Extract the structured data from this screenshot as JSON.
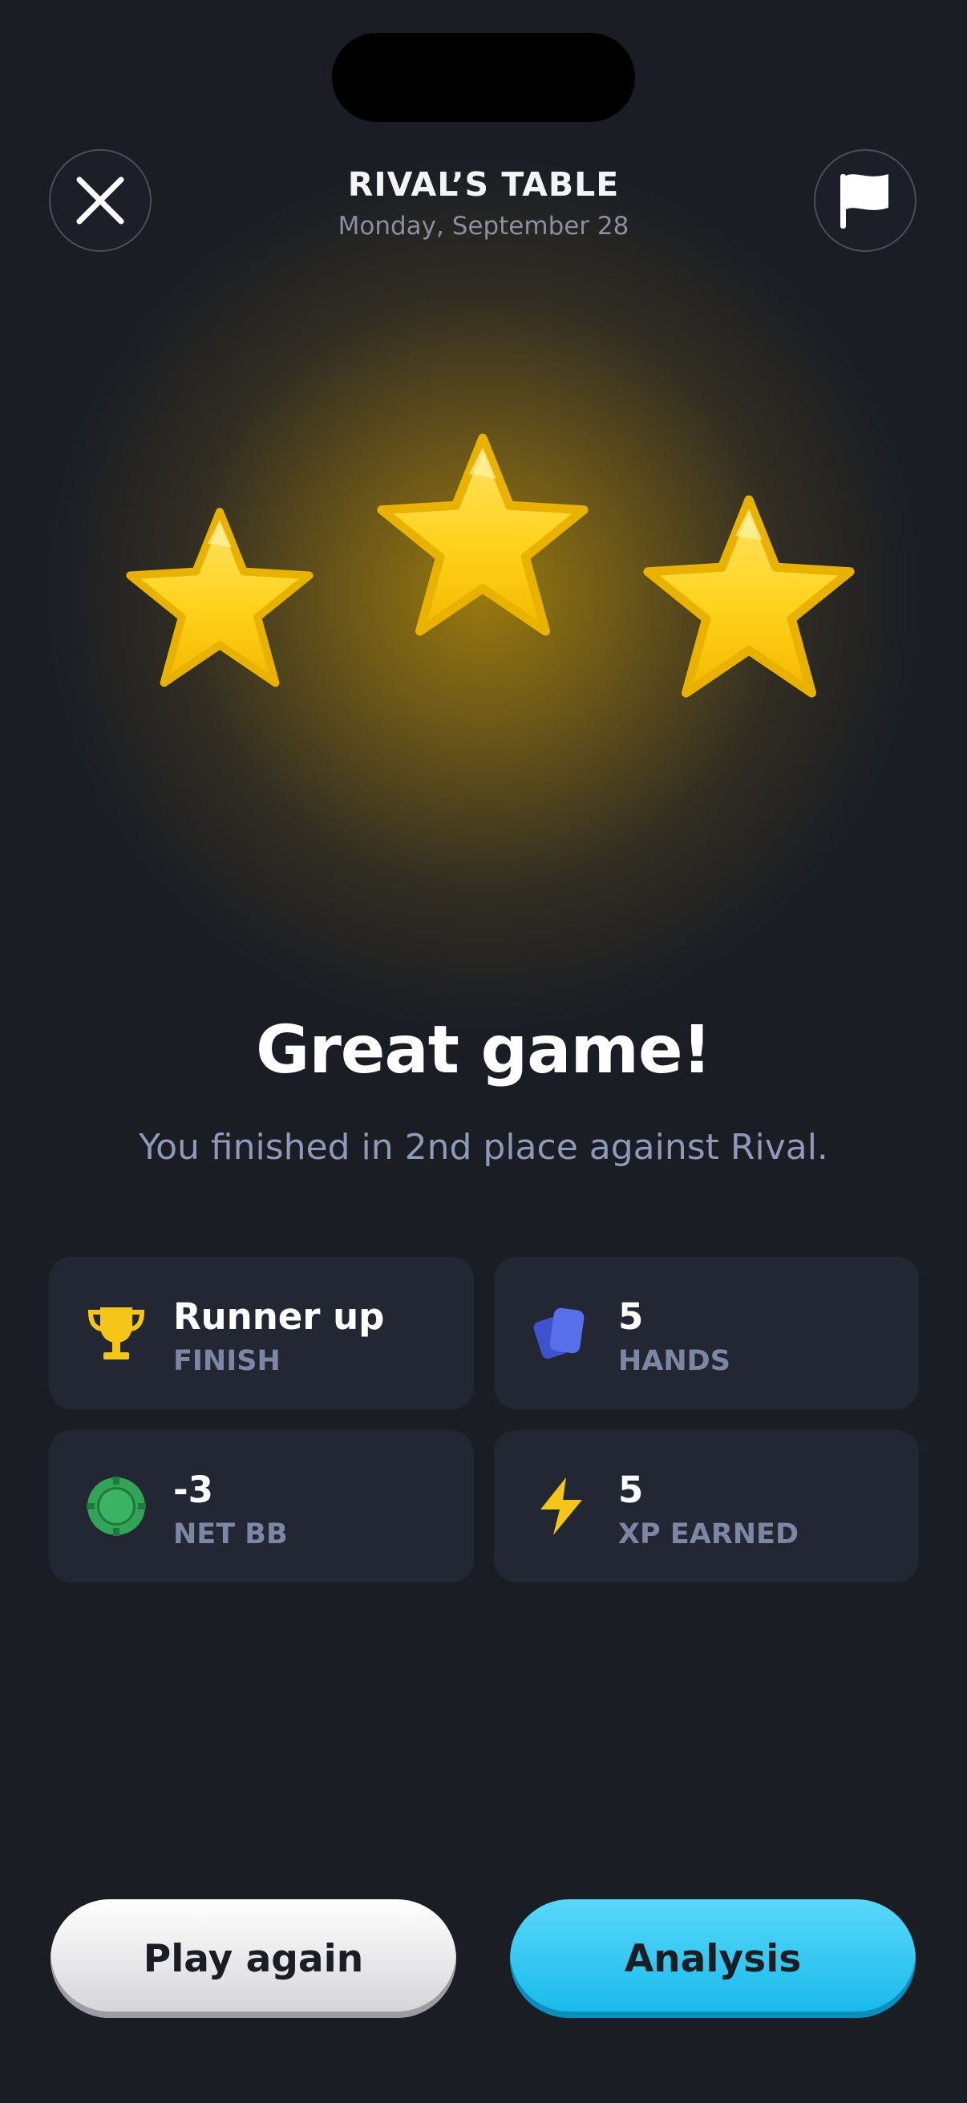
{
  "header": {
    "title": "RIVAL’S TABLE",
    "date": "Monday, September 28",
    "close_icon": "close-icon",
    "flag_icon": "flag-icon"
  },
  "rating": {
    "stars_earned": 3,
    "stars_total": 3,
    "star_color": "#ffcc1a"
  },
  "result": {
    "headline": "Great game!",
    "message": "You finished in 2nd place against Rival."
  },
  "stats": [
    {
      "icon": "trophy-icon",
      "value": "Runner up",
      "label": "FINISH",
      "color": "#f5c518"
    },
    {
      "icon": "cards-icon",
      "value": "5",
      "label": "HANDS",
      "color": "#4a62e0"
    },
    {
      "icon": "poker-chip-icon",
      "value": "-3",
      "label": "NET BB",
      "color": "#33a35a"
    },
    {
      "icon": "lightning-icon",
      "value": "5",
      "label": "XP EARNED",
      "color": "#f5c518"
    }
  ],
  "actions": {
    "play_again_label": "Play again",
    "analysis_label": "Analysis",
    "analysis_color": "#2bc6f2"
  }
}
